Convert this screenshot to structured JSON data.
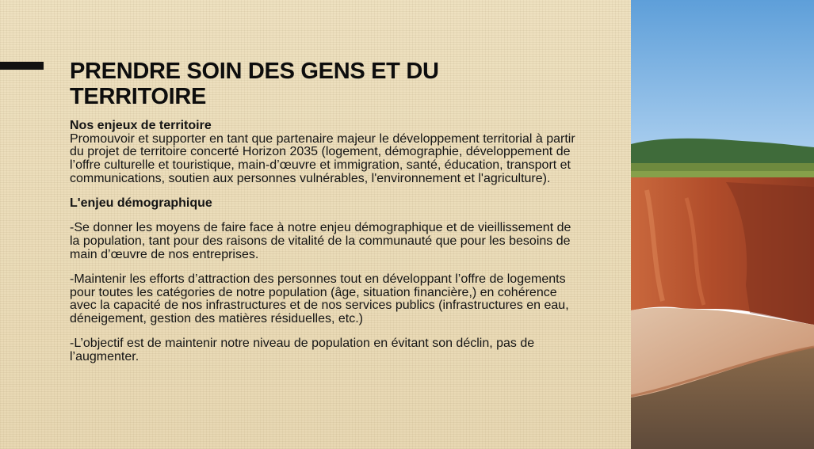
{
  "slide": {
    "title": "PRENDRE SOIN DES GENS ET DU TERRITOIRE",
    "sections": {
      "territoire_heading": "Nos enjeux de territoire",
      "territoire_text": "Promouvoir et supporter en tant que partenaire majeur le développement territorial à partir du projet de territoire concerté Horizon 2035 (logement, démographie, développement de l’offre culturelle et touristique, main-d’œuvre et immigration, santé, éducation, transport et communications, soutien aux personnes vulnérables, l'environnement et l'agriculture).",
      "demographique_heading": "L'enjeu démographique",
      "point_1": "-Se donner les moyens de faire face à notre enjeu démographique et de vieillissement de la population, tant pour des raisons de vitalité de la communauté que pour les besoins de main d’œuvre de nos entreprises.",
      "point_2": "-Maintenir les efforts d’attraction des personnes tout en développant l’offre de logements pour toutes les catégories de notre population (âge, situation financière,) en cohérence avec la capacité de nos infrastructures et de nos services publics (infrastructures en eau, déneigement, gestion des matières résiduelles, etc.)",
      "point_3": "-L’objectif est de maintenir notre niveau de population en évitant son déclin, pas de l’augmenter."
    }
  },
  "colors": {
    "paper": "#ebdcb8",
    "sky": "#7fb1e2",
    "cliff": "#b8532f",
    "accent": "#111111"
  }
}
